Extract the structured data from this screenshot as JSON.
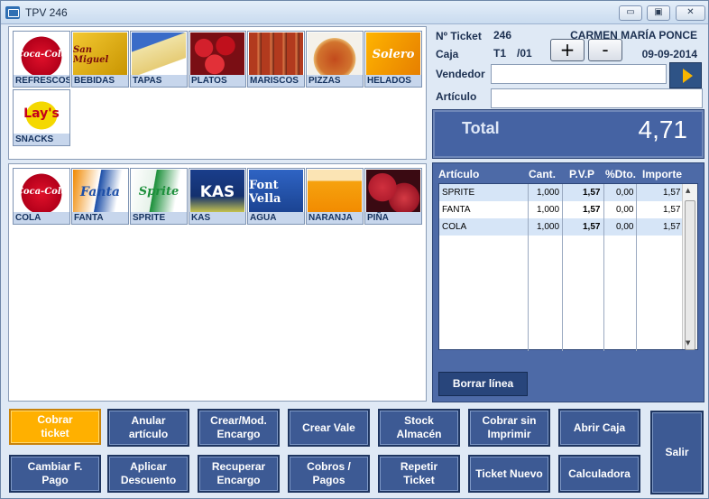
{
  "window": {
    "title": "TPV 246",
    "min_label": "▭",
    "max_label": "▣",
    "close_label": "✕"
  },
  "categories": [
    {
      "label": "REFRESCOS",
      "icon": "coca-cola-bottle-image",
      "color": "#c8001e"
    },
    {
      "label": "BEBIDAS",
      "icon": "san-miguel-beer-image",
      "color": "#d9a400"
    },
    {
      "label": "TAPAS",
      "icon": "cheese-tapas-image",
      "color": "#e8d89a"
    },
    {
      "label": "PLATOS",
      "icon": "strawberries-dish-image",
      "color": "#b3121a"
    },
    {
      "label": "MARISCOS",
      "icon": "shrimp-image",
      "color": "#c0402a"
    },
    {
      "label": "PIZZAS",
      "icon": "pizza-image",
      "color": "#b8501f"
    },
    {
      "label": "HELADOS",
      "icon": "solero-ice-cream-image",
      "color": "#f2a400"
    },
    {
      "label": "SNACKS",
      "icon": "lays-chips-image",
      "color": "#f5d900"
    }
  ],
  "products": [
    {
      "label": "COLA",
      "icon": "coca-cola-bottle-image",
      "color": "#c8001e"
    },
    {
      "label": "FANTA",
      "icon": "fanta-can-image",
      "color": "#f07800"
    },
    {
      "label": "SPRITE",
      "icon": "sprite-can-image",
      "color": "#1b8f3a"
    },
    {
      "label": "KAS",
      "icon": "kas-limon-can-image",
      "color": "#1a3e8c"
    },
    {
      "label": "AGUA",
      "icon": "font-vella-water-image",
      "color": "#1f55b4"
    },
    {
      "label": "NARANJA",
      "icon": "orange-juice-image",
      "color": "#f59a16"
    },
    {
      "label": "PIÑA",
      "icon": "pineapple-image",
      "color": "#b21d2e"
    }
  ],
  "ticket": {
    "number_label": "Nº Ticket",
    "number": "246",
    "operator": "CARMEN MARÍA PONCE",
    "caja_label": "Caja",
    "caja_value": "T1",
    "caja_suffix": "/01",
    "date": "09-09-2014",
    "plus_label": "+",
    "minus_label": "-",
    "vendedor_label": "Vendedor",
    "vendedor_value": "",
    "articulo_label": "Artículo",
    "articulo_value": ""
  },
  "total": {
    "label": "Total",
    "value": "4,71"
  },
  "grid": {
    "headers": [
      "Artículo",
      "Cant.",
      "P.V.P",
      "%Dto.",
      "Importe"
    ],
    "rows": [
      {
        "articulo": "SPRITE",
        "cant": "1,000",
        "pvp": "1,57",
        "dto": "0,00",
        "importe": "1,57"
      },
      {
        "articulo": "FANTA",
        "cant": "1,000",
        "pvp": "1,57",
        "dto": "0,00",
        "importe": "1,57"
      },
      {
        "articulo": "COLA",
        "cant": "1,000",
        "pvp": "1,57",
        "dto": "0,00",
        "importe": "1,57"
      }
    ],
    "borrar_label": "Borrar línea"
  },
  "buttons": {
    "cobrar_ticket": "Cobrar\nticket",
    "anular_articulo": "Anular\nartículo",
    "crear_mod_encargo": "Crear/Mod.\nEncargo",
    "crear_vale": "Crear Vale",
    "stock_almacen": "Stock\nAlmacén",
    "cobrar_sin_imprimir": "Cobrar sin\nImprimir",
    "abrir_caja": "Abrir Caja",
    "cambiar_f_pago": "Cambiar F.\nPago",
    "aplicar_descuento": "Aplicar\nDescuento",
    "recuperar_encargo": "Recuperar\nEncargo",
    "cobros_pagos": "Cobros /\nPagos",
    "repetir_ticket": "Repetir\nTicket",
    "ticket_nuevo": "Ticket Nuevo",
    "calculadora": "Calculadora",
    "salir": "Salir"
  }
}
